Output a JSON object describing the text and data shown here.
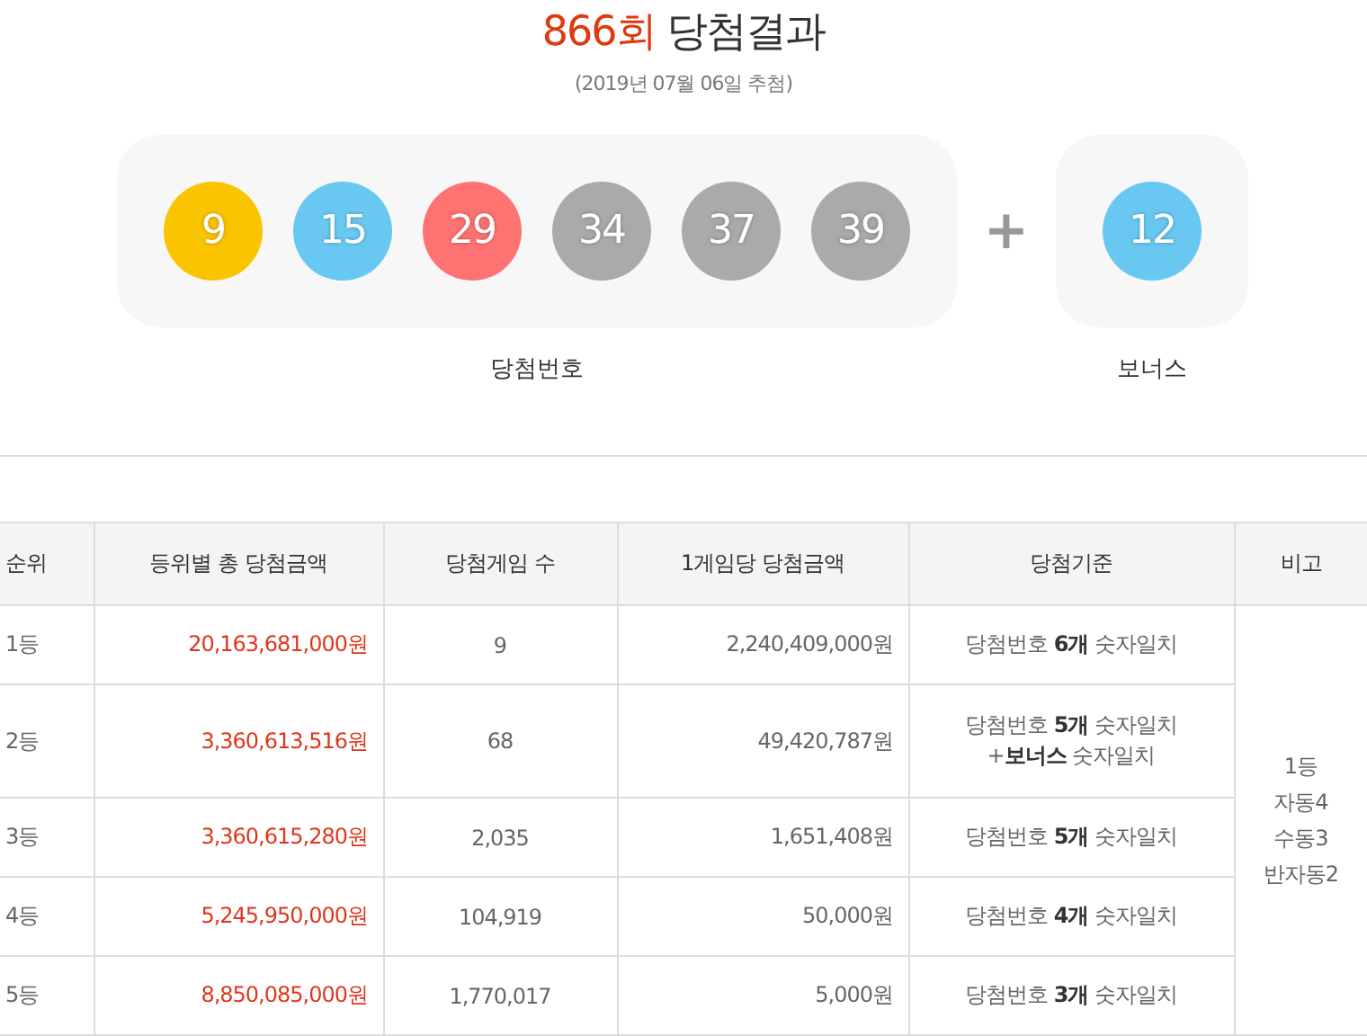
{
  "title": {
    "round": "866회",
    "text": "당첨결과",
    "date": "(2019년 07월 06일 추첨)"
  },
  "winning_numbers": {
    "balls": [
      {
        "number": "9",
        "color": "#fbc400"
      },
      {
        "number": "15",
        "color": "#69c8f2"
      },
      {
        "number": "29",
        "color": "#ff7272"
      },
      {
        "number": "34",
        "color": "#aaaaaa"
      },
      {
        "number": "37",
        "color": "#aaaaaa"
      },
      {
        "number": "39",
        "color": "#aaaaaa"
      }
    ],
    "label": "당첨번호"
  },
  "plus": "+",
  "bonus": {
    "ball": {
      "number": "12",
      "color": "#69c8f2"
    },
    "label": "보너스"
  },
  "table": {
    "columns": [
      "순위",
      "등위별 총 당첨금액",
      "당첨게임 수",
      "1게임당 당첨금액",
      "당첨기준",
      "비고"
    ],
    "rows": [
      {
        "rank": "1등",
        "total": "20,163,681,000원",
        "winners": "9",
        "per_game": "2,240,409,000원",
        "criteria": [
          "당첨번호 **6개** 숫자일치"
        ]
      },
      {
        "rank": "2등",
        "total": "3,360,613,516원",
        "winners": "68",
        "per_game": "49,420,787원",
        "criteria": [
          "당첨번호 **5개** 숫자일치",
          "+**보너스** 숫자일치"
        ]
      },
      {
        "rank": "3등",
        "total": "3,360,615,280원",
        "winners": "2,035",
        "per_game": "1,651,408원",
        "criteria": [
          "당첨번호 **5개** 숫자일치"
        ]
      },
      {
        "rank": "4등",
        "total": "5,245,950,000원",
        "winners": "104,919",
        "per_game": "50,000원",
        "criteria": [
          "당첨번호 **4개** 숫자일치"
        ]
      },
      {
        "rank": "5등",
        "total": "8,850,085,000원",
        "winners": "1,770,017",
        "per_game": "5,000원",
        "criteria": [
          "당첨번호 **3개** 숫자일치"
        ]
      }
    ],
    "note": [
      "1등",
      "자동4",
      "수동3",
      "반자동2"
    ]
  }
}
